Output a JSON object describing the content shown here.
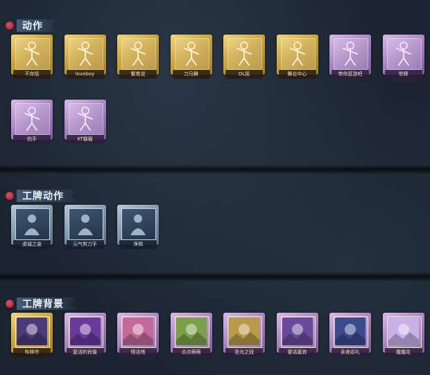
{
  "sections": {
    "actions": {
      "title": "动作",
      "items": [
        {
          "label": "不存括",
          "rarity": "gold",
          "icon": "dance-pose-icon"
        },
        {
          "label": "loveboy",
          "rarity": "gold",
          "icon": "heart-pose-icon"
        },
        {
          "label": "繁卷说",
          "rarity": "gold",
          "icon": "sway-pose-icon"
        },
        {
          "label": "刀马舞",
          "rarity": "gold",
          "icon": "sword-dance-icon"
        },
        {
          "label": "DL摇",
          "rarity": "gold",
          "icon": "shake-pose-icon"
        },
        {
          "label": "舞台中心",
          "rarity": "gold",
          "icon": "stage-center-icon"
        },
        {
          "label": "带你逛游吧",
          "rarity": "purple",
          "icon": "wave-pose-icon"
        },
        {
          "label": "举牌",
          "rarity": "purple",
          "icon": "sign-raise-icon"
        },
        {
          "label": "拍手",
          "rarity": "purple",
          "icon": "clap-icon"
        },
        {
          "label": "KT猫猫",
          "rarity": "purple",
          "icon": "cat-pose-icon"
        }
      ]
    },
    "card_actions": {
      "title": "工牌动作",
      "items": [
        {
          "label": "虔诚之姿",
          "rarity": "blue",
          "icon": "prayer-card-icon"
        },
        {
          "label": "元气剪刀手",
          "rarity": "blue",
          "icon": "peace-sign-card-icon"
        },
        {
          "label": "净揭",
          "rarity": "blue",
          "icon": "reveal-card-icon"
        }
      ]
    },
    "card_backgrounds": {
      "title": "工牌背景",
      "items": [
        {
          "label": "布林市",
          "rarity": "gold",
          "icon": "city-card-icon",
          "accent": "#4a3a7a"
        },
        {
          "label": "复活的肖像",
          "rarity": "purple",
          "icon": "portrait-card-icon",
          "accent": "#6a3a9a"
        },
        {
          "label": "情话塔",
          "rarity": "purple",
          "icon": "tower-card-icon",
          "accent": "#c46a9a"
        },
        {
          "label": "点点萌萌",
          "rarity": "purple",
          "icon": "sparkle-card-icon",
          "accent": "#7aa04a"
        },
        {
          "label": "圣光之冠",
          "rarity": "purple",
          "icon": "crown-card-icon",
          "accent": "#b89a4a"
        },
        {
          "label": "童话嘉宾",
          "rarity": "purple",
          "icon": "curtain-card-icon",
          "accent": "#6a4a9a"
        },
        {
          "label": "永夜巡礼",
          "rarity": "purple",
          "icon": "night-card-icon",
          "accent": "#3a4a8a"
        },
        {
          "label": "魔魔花",
          "rarity": "purple",
          "icon": "flower-card-icon",
          "accent": "#c8b0e8"
        }
      ]
    }
  }
}
